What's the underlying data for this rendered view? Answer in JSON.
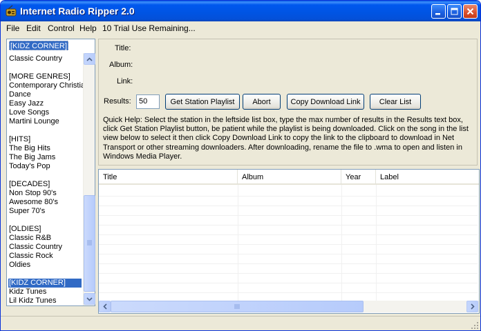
{
  "window": {
    "title": "Internet Radio Ripper 2.0"
  },
  "menu": {
    "file": "File",
    "edit": "Edit",
    "control": "Control",
    "help": "Help",
    "trial": "10 Trial Use Remaining..."
  },
  "stations": {
    "selected": "[KIDZ CORNER]",
    "top_item": "Classic Country",
    "items": [
      "",
      "[MORE GENRES]",
      "Contemporary Christian",
      "Dance",
      "Easy Jazz",
      "Love Songs",
      "Martini Lounge",
      "",
      "[HITS]",
      "The Big Hits",
      "The Big Jams",
      "Today's Pop",
      "",
      "[DECADES]",
      "Non Stop 90's",
      "Awesome 80's",
      "Super 70's",
      "",
      "[OLDIES]",
      "Classic R&B",
      "Classic Country",
      "Classic Rock",
      "Oldies",
      "",
      "[KIDZ CORNER]",
      "Kidz Tunes",
      "Lil Kidz Tunes"
    ],
    "selected_index": 24
  },
  "form": {
    "title_label": "Title:",
    "album_label": "Album:",
    "link_label": "Link:",
    "results_label": "Results:",
    "results_value": "50",
    "get_playlist": "Get Station Playlist",
    "abort": "Abort",
    "copy_link": "Copy Download Link",
    "clear_list": "Clear List",
    "quick_help": "Quick Help: Select the station in the leftside list box, type the max number of results in the Results text box, click Get Station Playlist button, be patient while the playlist is being downloaded. Click on the song in the list view  below to select it then click Copy Download Link to  copy the link to the clipboard to download  in Net Transport or other streaming downloaders. After downloading, rename the file to .wma to open and listen in Windows Media Player."
  },
  "table": {
    "columns": [
      "Title",
      "Album",
      "Year",
      "Label"
    ]
  },
  "colors": {
    "titlebar": "#0054e3",
    "selection": "#316ac5",
    "face": "#ece9d8"
  }
}
